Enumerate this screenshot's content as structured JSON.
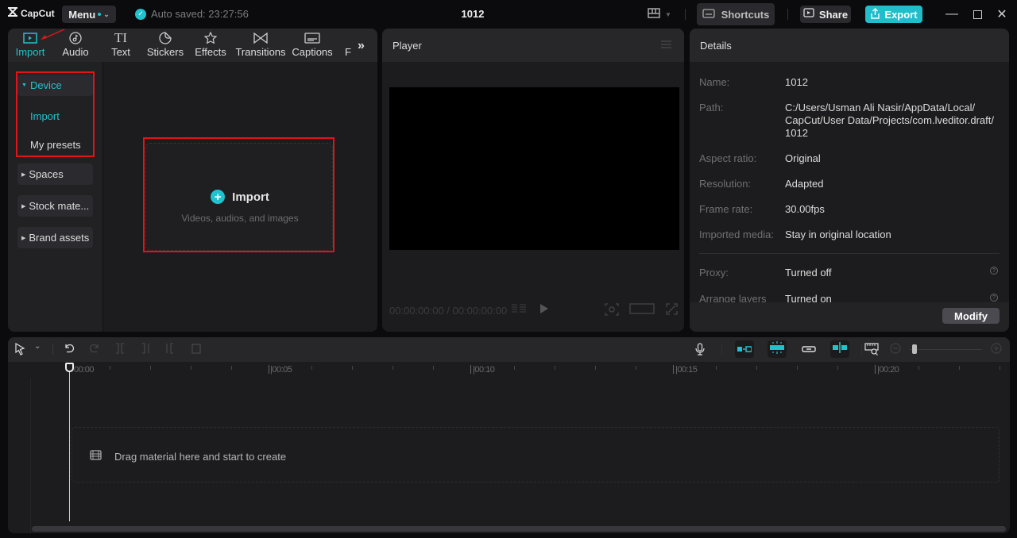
{
  "titlebar": {
    "app_name": "CapCut",
    "menu_label": "Menu",
    "autosave_text": "Auto saved: 23:27:56",
    "project_title": "1012",
    "shortcuts_label": "Shortcuts",
    "share_label": "Share",
    "export_label": "Export",
    "accent_color": "#21c2cf"
  },
  "media_tabs": [
    {
      "label": "Import",
      "icon": "import-icon",
      "active": true
    },
    {
      "label": "Audio",
      "icon": "audio-icon"
    },
    {
      "label": "Text",
      "icon": "text-icon",
      "glyph": "TI"
    },
    {
      "label": "Stickers",
      "icon": "stickers-icon"
    },
    {
      "label": "Effects",
      "icon": "effects-icon"
    },
    {
      "label": "Transitions",
      "icon": "transitions-icon"
    },
    {
      "label": "Captions",
      "icon": "captions-icon"
    },
    {
      "label": "F",
      "icon": "filters-icon"
    }
  ],
  "sidebar": {
    "device": "Device",
    "device_sub": [
      "Import",
      "My presets"
    ],
    "spaces": "Spaces",
    "stock": "Stock mate...",
    "brand": "Brand assets"
  },
  "import_card": {
    "title": "Import",
    "subtitle": "Videos, audios, and images"
  },
  "player": {
    "title": "Player",
    "timecode": "00:00:00:00 / 00:00:00:00"
  },
  "details": {
    "title": "Details",
    "rows": [
      {
        "label": "Name:",
        "value": "1012"
      },
      {
        "label": "Path:",
        "value": "C:/Users/Usman Ali Nasir/AppData/Local/ CapCut/User Data/Projects/com.lveditor.draft/ 1012"
      },
      {
        "label": "Aspect ratio:",
        "value": "Original"
      },
      {
        "label": "Resolution:",
        "value": "Adapted"
      },
      {
        "label": "Frame rate:",
        "value": "30.00fps"
      },
      {
        "label": "Imported media:",
        "value": "Stay in original location"
      },
      {
        "label": "Proxy:",
        "value": "Turned off"
      },
      {
        "label": "Arrange layers",
        "value": "Turned on"
      }
    ],
    "modify_label": "Modify"
  },
  "timeline": {
    "ruler_labels": [
      "00:00",
      "|00:05",
      "|00:10",
      "|00:15",
      "|00:20"
    ],
    "drop_text": "Drag material here and start to create",
    "zoom_level": 0.05
  }
}
